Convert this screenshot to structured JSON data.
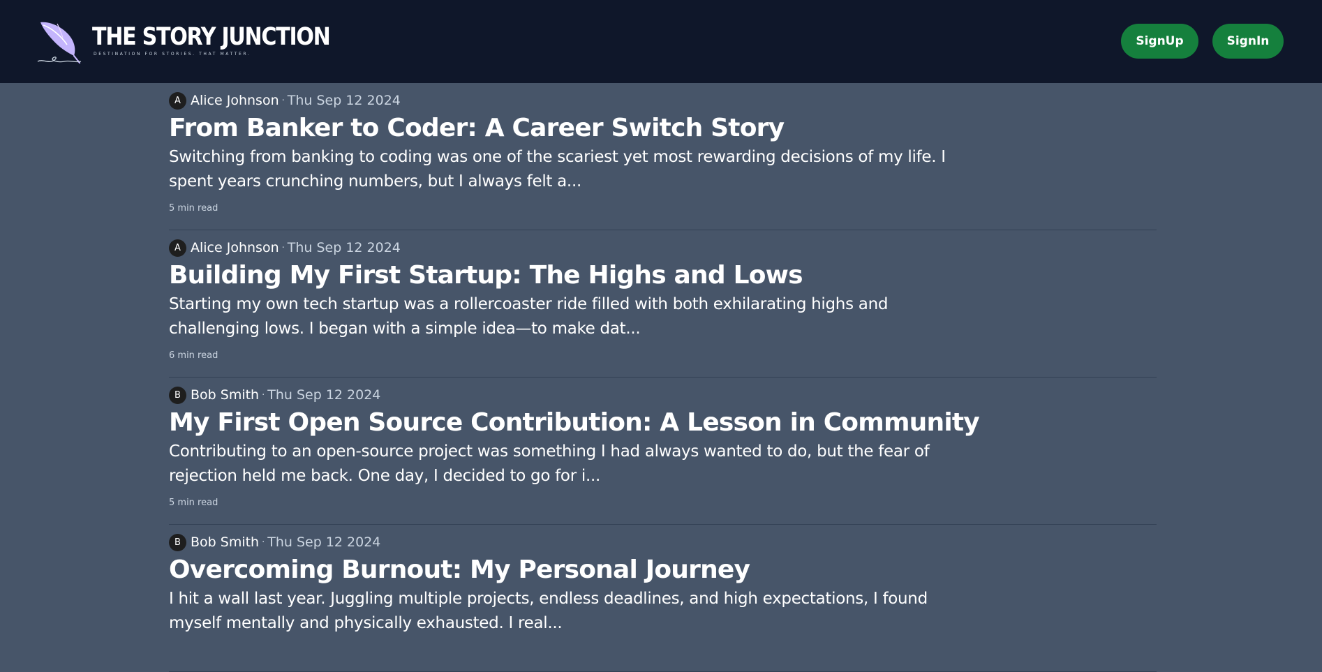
{
  "header": {
    "logo_title": "THE STORY JUNCTION",
    "logo_tagline": "DESTINATION FOR STORIES. THAT MATTER.",
    "signup_label": "SignUp",
    "signin_label": "SignIn"
  },
  "colors": {
    "header_bg": "#0f172a",
    "page_bg": "#475569",
    "button_bg": "#15803d",
    "logo_accent": "#c4b5fd"
  },
  "posts": [
    {
      "avatar_initial": "A",
      "author": "Alice Johnson",
      "separator": "·",
      "date": "Thu Sep 12 2024",
      "title": "From Banker to Coder: A Career Switch Story",
      "excerpt": "Switching from banking to coding was one of the scariest yet most rewarding decisions of my life. I spent years crunching numbers, but I always felt a...",
      "read_time": "5 min read"
    },
    {
      "avatar_initial": "A",
      "author": "Alice Johnson",
      "separator": "·",
      "date": "Thu Sep 12 2024",
      "title": "Building My First Startup: The Highs and Lows",
      "excerpt": "Starting my own tech startup was a rollercoaster ride filled with both exhilarating highs and challenging lows. I began with a simple idea—to make dat...",
      "read_time": "6 min read"
    },
    {
      "avatar_initial": "B",
      "author": "Bob Smith",
      "separator": "·",
      "date": "Thu Sep 12 2024",
      "title": "My First Open Source Contribution: A Lesson in Community",
      "excerpt": "Contributing to an open-source project was something I had always wanted to do, but the fear of rejection held me back. One day, I decided to go for i...",
      "read_time": "5 min read"
    },
    {
      "avatar_initial": "B",
      "author": "Bob Smith",
      "separator": "·",
      "date": "Thu Sep 12 2024",
      "title": "Overcoming Burnout: My Personal Journey",
      "excerpt": "I hit a wall last year. Juggling multiple projects, endless deadlines, and high expectations, I found myself mentally and physically exhausted. I real...",
      "read_time": ""
    }
  ]
}
